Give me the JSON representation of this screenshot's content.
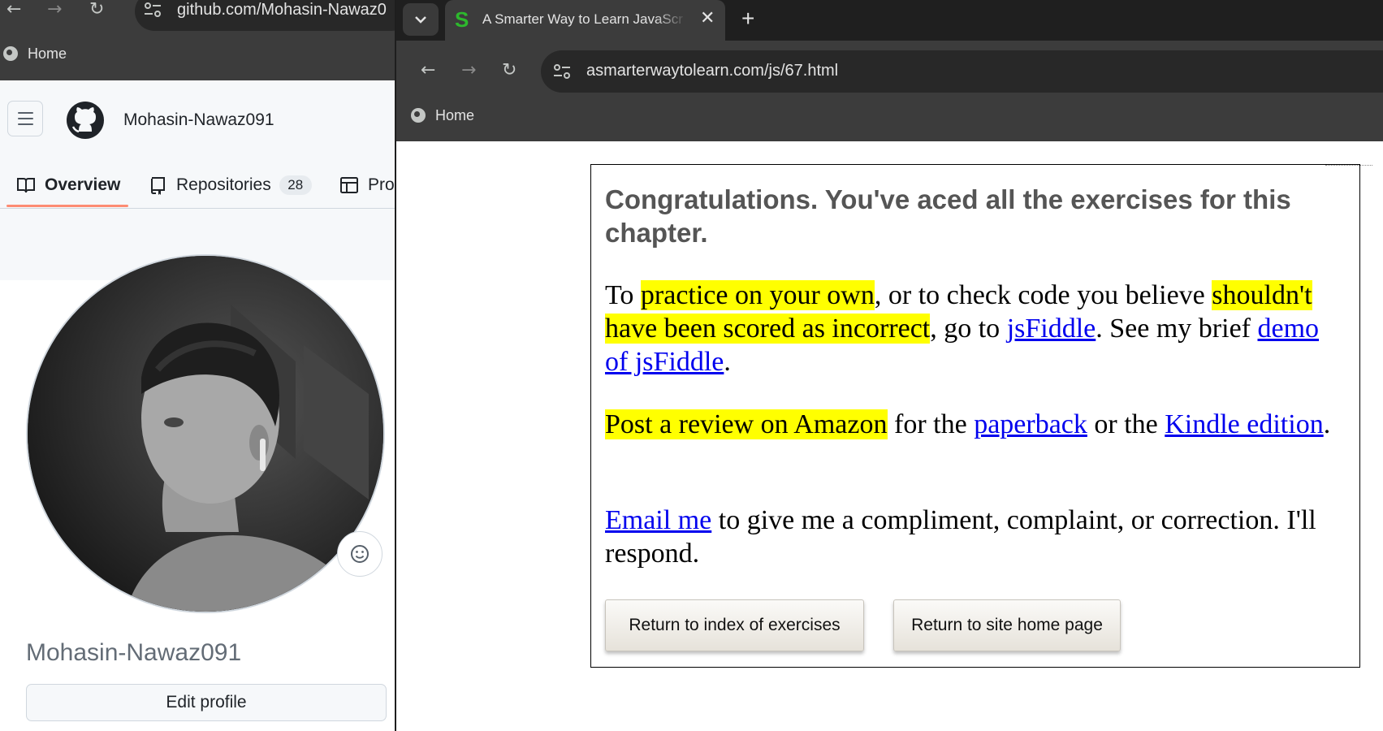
{
  "left_browser": {
    "url": "github.com/Mohasin-Nawaz0",
    "bookmark_home": "Home"
  },
  "github": {
    "header_username": "Mohasin-Nawaz091",
    "tabs": [
      {
        "label": "Overview",
        "icon": "book-icon",
        "active": true
      },
      {
        "label": "Repositories",
        "icon": "repo-icon",
        "count": "28"
      },
      {
        "label": "Pro",
        "icon": "table-icon"
      }
    ],
    "profile_name": "Mohasin-Nawaz091",
    "edit_profile_label": "Edit profile",
    "accent_color": "#fd8c73"
  },
  "right_browser": {
    "tab_title": "A Smarter Way to Learn JavaScr",
    "favicon": "S",
    "url": "asmarterwaytolearn.com/js/67.html",
    "bookmark_home": "Home"
  },
  "page": {
    "heading": "Congratulations. You've aced all the exercises for this chapter.",
    "p1": {
      "t1": "To ",
      "h1": "practice on your own",
      "t2": ", or to check code you believe ",
      "h2": "shouldn't have been scored as incorrect",
      "t3": ", go to ",
      "link1": "jsFiddle",
      "t4": ". See my brief ",
      "link2": "demo of jsFiddle",
      "t5": "."
    },
    "p2": {
      "h1": "Post a review on Amazon",
      "t1": " for the ",
      "link1": "paperback",
      "t2": " or the ",
      "link2": "Kindle edition",
      "t3": "."
    },
    "p3": {
      "link1": "Email me",
      "t1": " to give me a compliment, complaint, or correction. I'll respond."
    },
    "buttons": {
      "index": "Return to index of exercises",
      "home": "Return to site home page"
    },
    "highlight_color": "#ffff00",
    "link_color": "#0000ee"
  }
}
